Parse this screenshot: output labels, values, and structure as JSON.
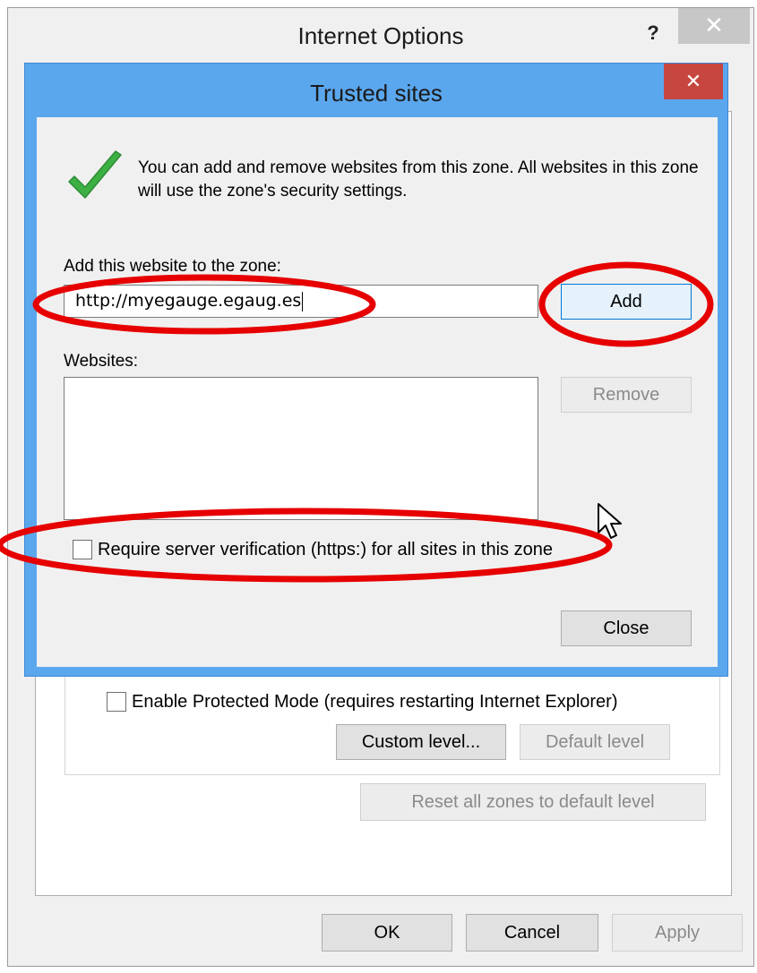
{
  "internet_options": {
    "title": "Internet Options",
    "help_glyph": "?",
    "close_glyph": "✕",
    "protected_mode_label": "Enable Protected Mode (requires restarting Internet Explorer)",
    "custom_level_label": "Custom level...",
    "default_level_label": "Default level",
    "reset_zones_label": "Reset all zones to default level",
    "ok_label": "OK",
    "cancel_label": "Cancel",
    "apply_label": "Apply"
  },
  "trusted_sites": {
    "title": "Trusted sites",
    "close_glyph": "✕",
    "info_text": "You can add and remove websites from this zone. All websites in this zone will use the zone's security settings.",
    "add_label": "Add this website to the zone:",
    "website_value": "http://myegauge.egaug.es",
    "add_button": "Add",
    "websites_label": "Websites:",
    "websites": [],
    "remove_button": "Remove",
    "require_verification_label": "Require server verification (https:) for all sites in this zone",
    "require_verification_checked": false,
    "close_button": "Close"
  },
  "colors": {
    "dialog_frame": "#5ba7ee",
    "close_button": "#c7463f",
    "annotation": "#e60000",
    "check": "#3cb043"
  }
}
